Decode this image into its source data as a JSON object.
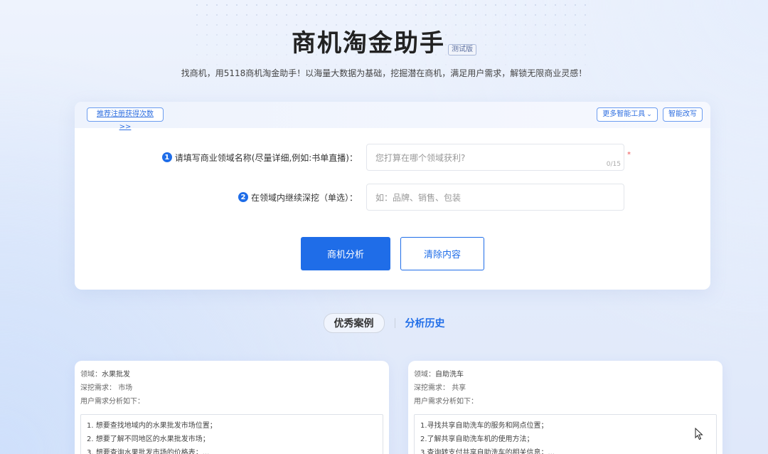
{
  "header": {
    "title": "商机淘金助手",
    "badge": "测试版",
    "subtitle": "找商机，用5118商机淘金助手！以海量大数据为基础，挖掘潜在商机，满足用户需求，解锁无限商业灵感！"
  },
  "toolbar": {
    "promo_link": "推荐注册获得次数>>",
    "more_tools": "更多智能工具",
    "smart_rewrite": "智能改写"
  },
  "form": {
    "field1": {
      "number": "1",
      "label": "请填写商业领域名称(尽量详细,例如:书单直播)：",
      "placeholder": "您打算在哪个领域获利?",
      "counter": "0/15",
      "required_mark": "*"
    },
    "field2": {
      "number": "2",
      "label": "在领域内继续深挖（单选）：",
      "placeholder": "如：品牌、销售、包装"
    },
    "analyze_button": "商机分析",
    "clear_button": "清除内容"
  },
  "tabs": {
    "cases": "优秀案例",
    "history": "分析历史"
  },
  "cases": [
    {
      "domain_label": "领域：",
      "domain_value": "水果批发",
      "dig_label": "深挖需求：",
      "dig_value": "市场",
      "analysis_label": "用户需求分析如下：",
      "items": [
        "1. 想要查找地域内的水果批发市场位置；",
        "2. 想要了解不同地区的水果批发市场；",
        "3. 想要查询水果批发市场的价格表；..."
      ]
    },
    {
      "domain_label": "领域：",
      "domain_value": "自助洗车",
      "dig_label": "深挖需求：",
      "dig_value": "共享",
      "analysis_label": "用户需求分析如下：",
      "items": [
        "1.寻找共享自助洗车的服务和网点位置；",
        "2.了解共享自助洗车机的使用方法；",
        "3.查询转支付共享自助洗车的相关信息；..."
      ]
    }
  ],
  "colors": {
    "accent": "#1f6de8",
    "background": "#e6edfb"
  }
}
